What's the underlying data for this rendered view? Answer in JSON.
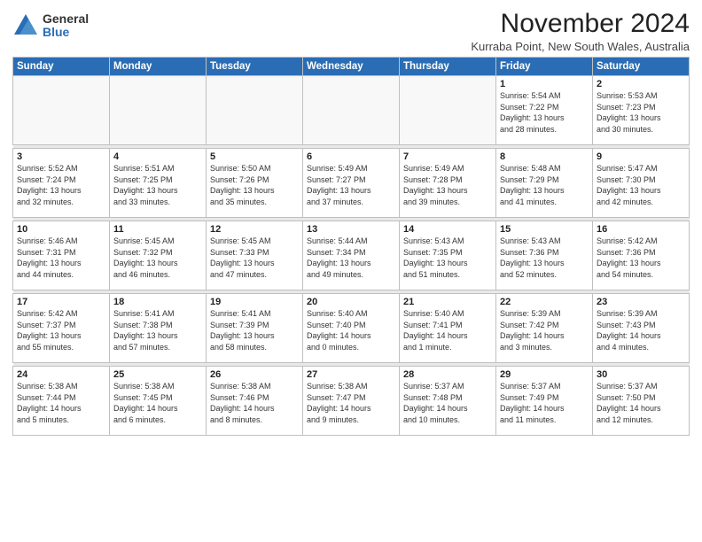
{
  "logo": {
    "general": "General",
    "blue": "Blue"
  },
  "title": "November 2024",
  "location": "Kurraba Point, New South Wales, Australia",
  "weekdays": [
    "Sunday",
    "Monday",
    "Tuesday",
    "Wednesday",
    "Thursday",
    "Friday",
    "Saturday"
  ],
  "weeks": [
    [
      {
        "day": "",
        "info": ""
      },
      {
        "day": "",
        "info": ""
      },
      {
        "day": "",
        "info": ""
      },
      {
        "day": "",
        "info": ""
      },
      {
        "day": "",
        "info": ""
      },
      {
        "day": "1",
        "info": "Sunrise: 5:54 AM\nSunset: 7:22 PM\nDaylight: 13 hours\nand 28 minutes."
      },
      {
        "day": "2",
        "info": "Sunrise: 5:53 AM\nSunset: 7:23 PM\nDaylight: 13 hours\nand 30 minutes."
      }
    ],
    [
      {
        "day": "3",
        "info": "Sunrise: 5:52 AM\nSunset: 7:24 PM\nDaylight: 13 hours\nand 32 minutes."
      },
      {
        "day": "4",
        "info": "Sunrise: 5:51 AM\nSunset: 7:25 PM\nDaylight: 13 hours\nand 33 minutes."
      },
      {
        "day": "5",
        "info": "Sunrise: 5:50 AM\nSunset: 7:26 PM\nDaylight: 13 hours\nand 35 minutes."
      },
      {
        "day": "6",
        "info": "Sunrise: 5:49 AM\nSunset: 7:27 PM\nDaylight: 13 hours\nand 37 minutes."
      },
      {
        "day": "7",
        "info": "Sunrise: 5:49 AM\nSunset: 7:28 PM\nDaylight: 13 hours\nand 39 minutes."
      },
      {
        "day": "8",
        "info": "Sunrise: 5:48 AM\nSunset: 7:29 PM\nDaylight: 13 hours\nand 41 minutes."
      },
      {
        "day": "9",
        "info": "Sunrise: 5:47 AM\nSunset: 7:30 PM\nDaylight: 13 hours\nand 42 minutes."
      }
    ],
    [
      {
        "day": "10",
        "info": "Sunrise: 5:46 AM\nSunset: 7:31 PM\nDaylight: 13 hours\nand 44 minutes."
      },
      {
        "day": "11",
        "info": "Sunrise: 5:45 AM\nSunset: 7:32 PM\nDaylight: 13 hours\nand 46 minutes."
      },
      {
        "day": "12",
        "info": "Sunrise: 5:45 AM\nSunset: 7:33 PM\nDaylight: 13 hours\nand 47 minutes."
      },
      {
        "day": "13",
        "info": "Sunrise: 5:44 AM\nSunset: 7:34 PM\nDaylight: 13 hours\nand 49 minutes."
      },
      {
        "day": "14",
        "info": "Sunrise: 5:43 AM\nSunset: 7:35 PM\nDaylight: 13 hours\nand 51 minutes."
      },
      {
        "day": "15",
        "info": "Sunrise: 5:43 AM\nSunset: 7:36 PM\nDaylight: 13 hours\nand 52 minutes."
      },
      {
        "day": "16",
        "info": "Sunrise: 5:42 AM\nSunset: 7:36 PM\nDaylight: 13 hours\nand 54 minutes."
      }
    ],
    [
      {
        "day": "17",
        "info": "Sunrise: 5:42 AM\nSunset: 7:37 PM\nDaylight: 13 hours\nand 55 minutes."
      },
      {
        "day": "18",
        "info": "Sunrise: 5:41 AM\nSunset: 7:38 PM\nDaylight: 13 hours\nand 57 minutes."
      },
      {
        "day": "19",
        "info": "Sunrise: 5:41 AM\nSunset: 7:39 PM\nDaylight: 13 hours\nand 58 minutes."
      },
      {
        "day": "20",
        "info": "Sunrise: 5:40 AM\nSunset: 7:40 PM\nDaylight: 14 hours\nand 0 minutes."
      },
      {
        "day": "21",
        "info": "Sunrise: 5:40 AM\nSunset: 7:41 PM\nDaylight: 14 hours\nand 1 minute."
      },
      {
        "day": "22",
        "info": "Sunrise: 5:39 AM\nSunset: 7:42 PM\nDaylight: 14 hours\nand 3 minutes."
      },
      {
        "day": "23",
        "info": "Sunrise: 5:39 AM\nSunset: 7:43 PM\nDaylight: 14 hours\nand 4 minutes."
      }
    ],
    [
      {
        "day": "24",
        "info": "Sunrise: 5:38 AM\nSunset: 7:44 PM\nDaylight: 14 hours\nand 5 minutes."
      },
      {
        "day": "25",
        "info": "Sunrise: 5:38 AM\nSunset: 7:45 PM\nDaylight: 14 hours\nand 6 minutes."
      },
      {
        "day": "26",
        "info": "Sunrise: 5:38 AM\nSunset: 7:46 PM\nDaylight: 14 hours\nand 8 minutes."
      },
      {
        "day": "27",
        "info": "Sunrise: 5:38 AM\nSunset: 7:47 PM\nDaylight: 14 hours\nand 9 minutes."
      },
      {
        "day": "28",
        "info": "Sunrise: 5:37 AM\nSunset: 7:48 PM\nDaylight: 14 hours\nand 10 minutes."
      },
      {
        "day": "29",
        "info": "Sunrise: 5:37 AM\nSunset: 7:49 PM\nDaylight: 14 hours\nand 11 minutes."
      },
      {
        "day": "30",
        "info": "Sunrise: 5:37 AM\nSunset: 7:50 PM\nDaylight: 14 hours\nand 12 minutes."
      }
    ]
  ]
}
